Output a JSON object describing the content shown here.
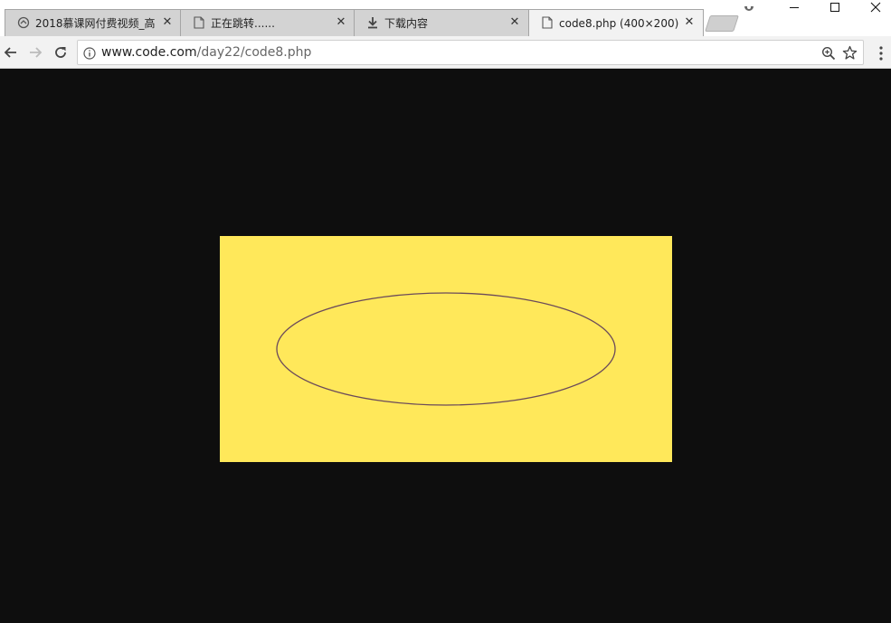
{
  "tabs": [
    {
      "title": "2018慕课网付费视频_高",
      "icon": "cloud-icon"
    },
    {
      "title": "正在跳转......",
      "icon": "page-icon"
    },
    {
      "title": "下载内容",
      "icon": "download-icon"
    },
    {
      "title": "code8.php (400×200)",
      "icon": "page-icon"
    }
  ],
  "active_tab": 3,
  "address_bar": {
    "host": "www.code.com",
    "path": "/day22/code8.php"
  },
  "image": {
    "background_color": "#ffe85a",
    "ellipse_stroke_color": "#6b4a5a"
  },
  "page_background_color": "#0e0e0e"
}
